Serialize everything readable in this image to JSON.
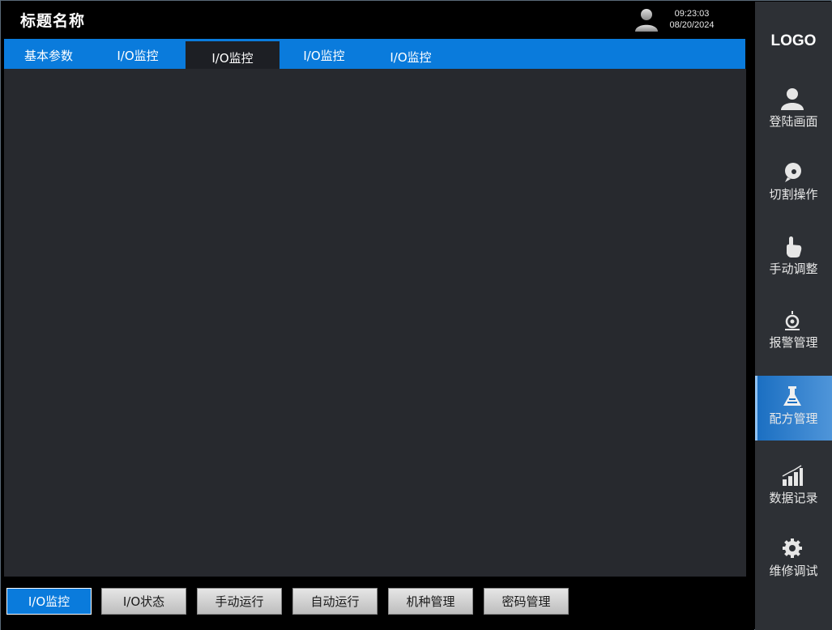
{
  "header": {
    "title": "标题名称",
    "time": "09:23:03",
    "date": "08/20/2024"
  },
  "tabs": [
    {
      "label": "基本参数",
      "active": false
    },
    {
      "label": "I/O监控",
      "active": false
    },
    {
      "label": "I/O监控",
      "active": true
    },
    {
      "label": "I/O监控",
      "active": false
    },
    {
      "label": "I/O监控",
      "active": false
    }
  ],
  "bottom_buttons": [
    {
      "label": "I/O监控",
      "active": true
    },
    {
      "label": "I/O状态",
      "active": false
    },
    {
      "label": "手动运行",
      "active": false
    },
    {
      "label": "自动运行",
      "active": false
    },
    {
      "label": "机种管理",
      "active": false
    },
    {
      "label": "密码管理",
      "active": false
    }
  ],
  "sidebar": {
    "logo": "LOGO",
    "items": [
      {
        "label": "登陆画面",
        "icon": "user-icon",
        "active": false
      },
      {
        "label": "切割操作",
        "icon": "disc-icon",
        "active": false
      },
      {
        "label": "手动调整",
        "icon": "hand-pointer-icon",
        "active": false
      },
      {
        "label": "报警管理",
        "icon": "alarm-icon",
        "active": false
      },
      {
        "label": "配方管理",
        "icon": "flask-icon",
        "active": true
      },
      {
        "label": "数据记录",
        "icon": "bar-chart-icon",
        "active": false
      },
      {
        "label": "维修调试",
        "icon": "gear-icon",
        "active": false
      }
    ]
  },
  "colors": {
    "accent": "#0a7bdc",
    "content_bg": "#27292e",
    "sidebar_bg": "#2d3035"
  }
}
